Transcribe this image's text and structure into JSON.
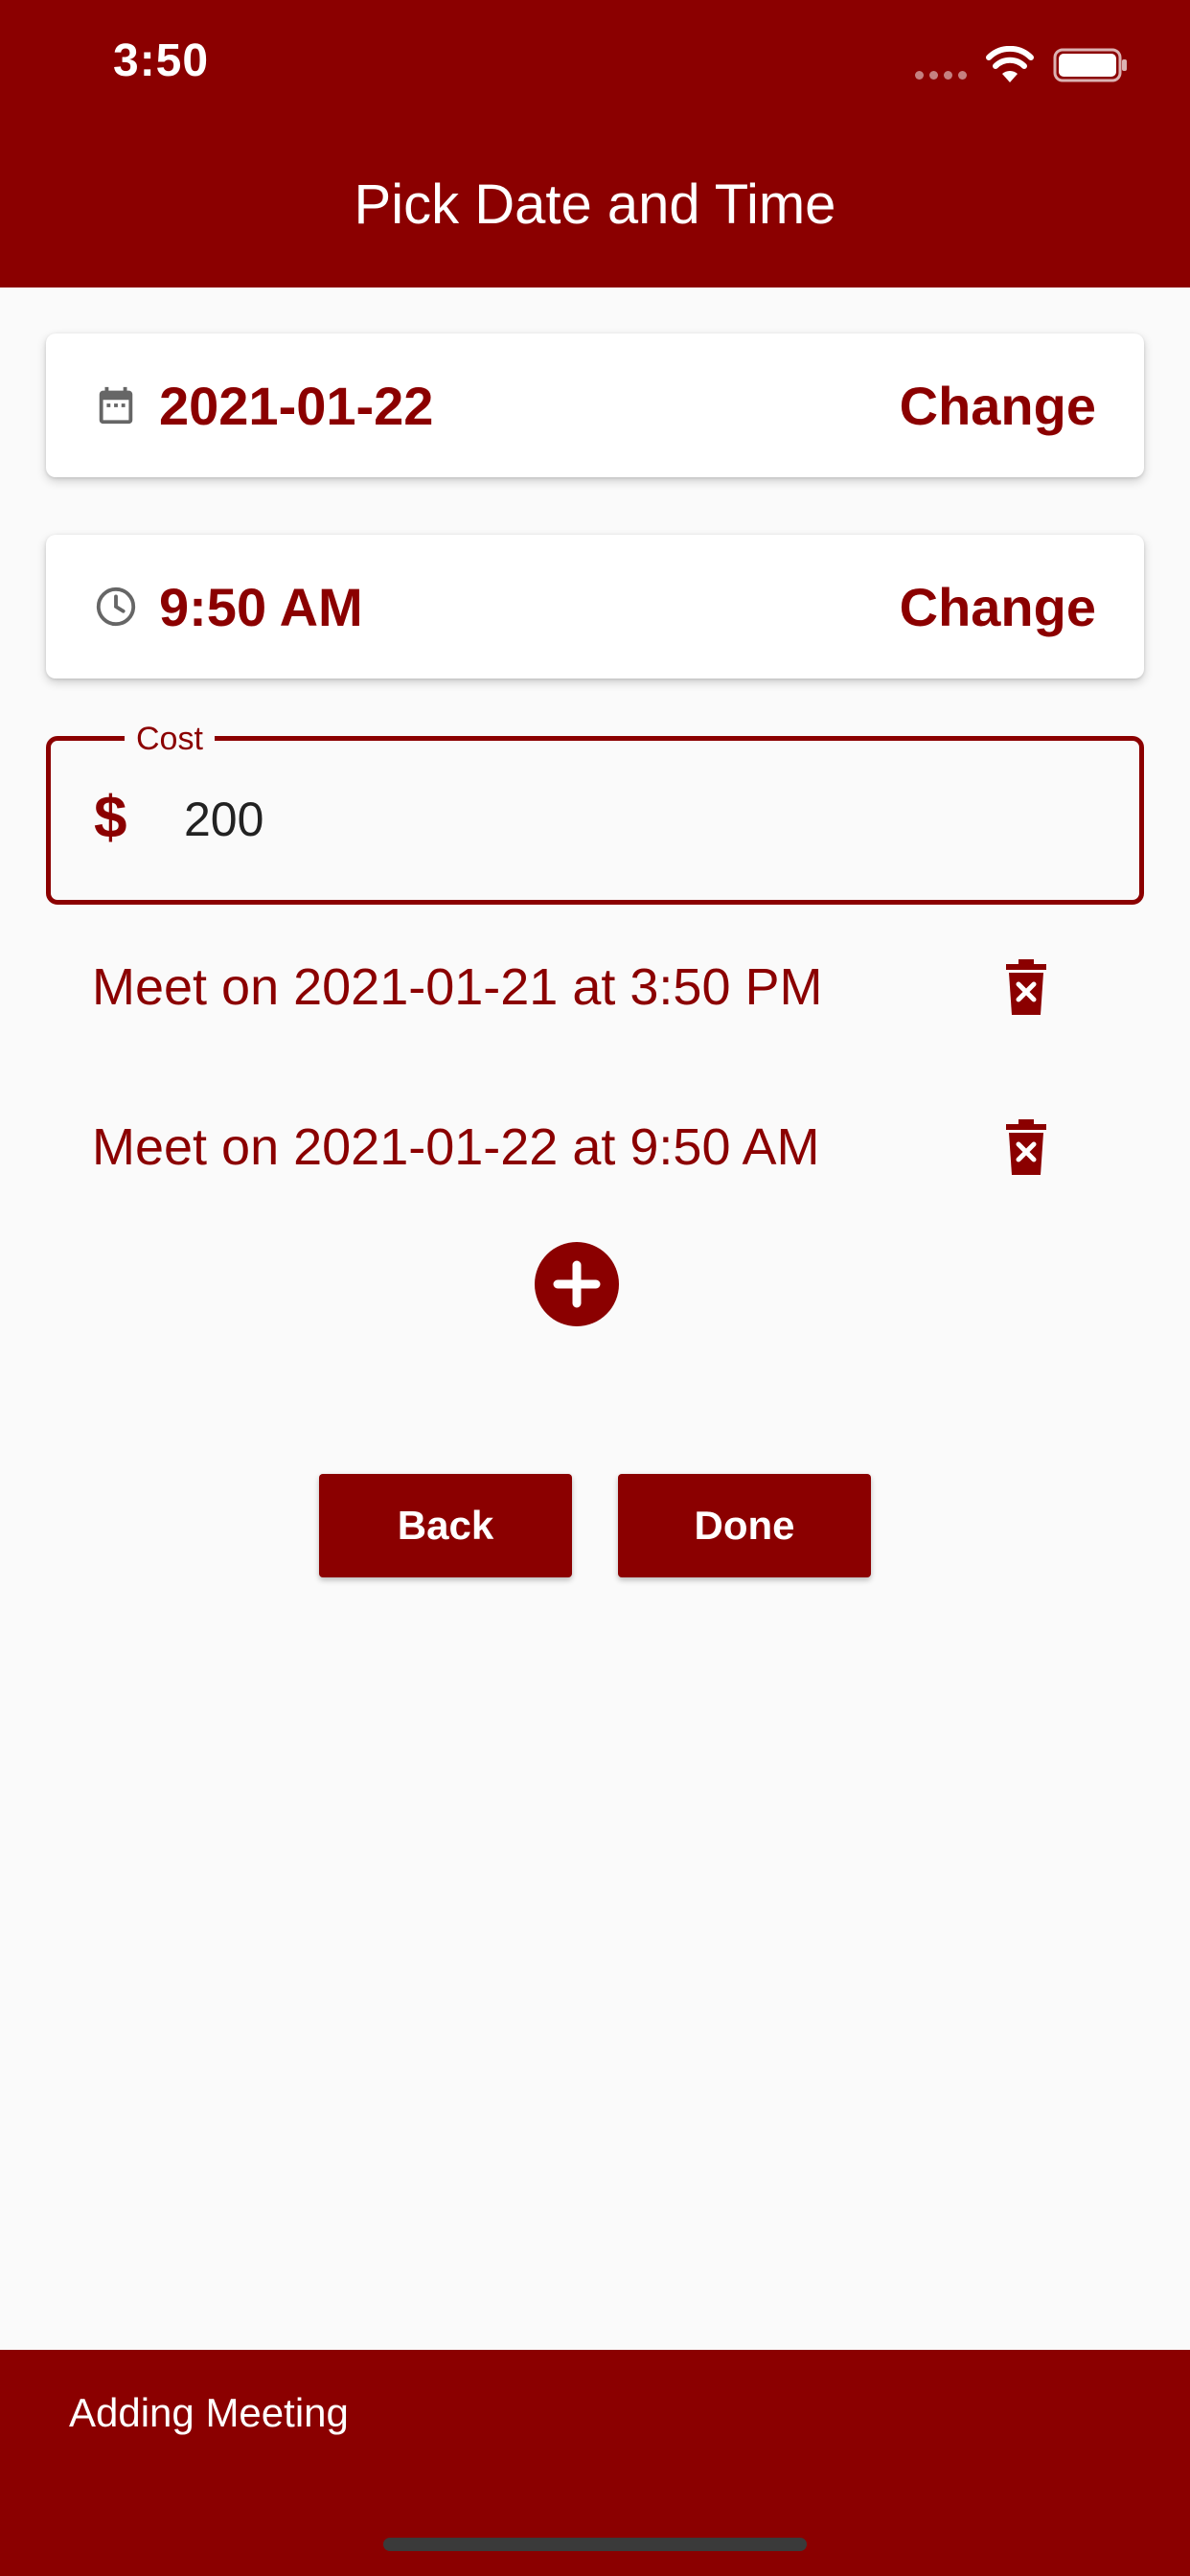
{
  "colors": {
    "accent": "#8b0000",
    "background": "#fafafa",
    "text_on_accent": "#ffffff"
  },
  "status_bar": {
    "time": "3:50"
  },
  "header": {
    "title": "Pick Date and Time"
  },
  "date_card": {
    "icon": "calendar-icon",
    "value": "2021-01-22",
    "change_label": "Change"
  },
  "time_card": {
    "icon": "clock-icon",
    "value": "9:50 AM",
    "change_label": "Change"
  },
  "cost": {
    "label": "Cost",
    "prefix_icon": "dollar-icon",
    "prefix": "$",
    "value": "200"
  },
  "meetings": [
    {
      "text": "Meet on 2021-01-21 at 3:50 PM",
      "icon": "trash-icon"
    },
    {
      "text": "Meet on 2021-01-22 at 9:50 AM",
      "icon": "trash-icon"
    }
  ],
  "add_button": {
    "icon": "plus-circle-icon"
  },
  "actions": {
    "back_label": "Back",
    "done_label": "Done"
  },
  "bottom_bar": {
    "text": "Adding Meeting"
  }
}
